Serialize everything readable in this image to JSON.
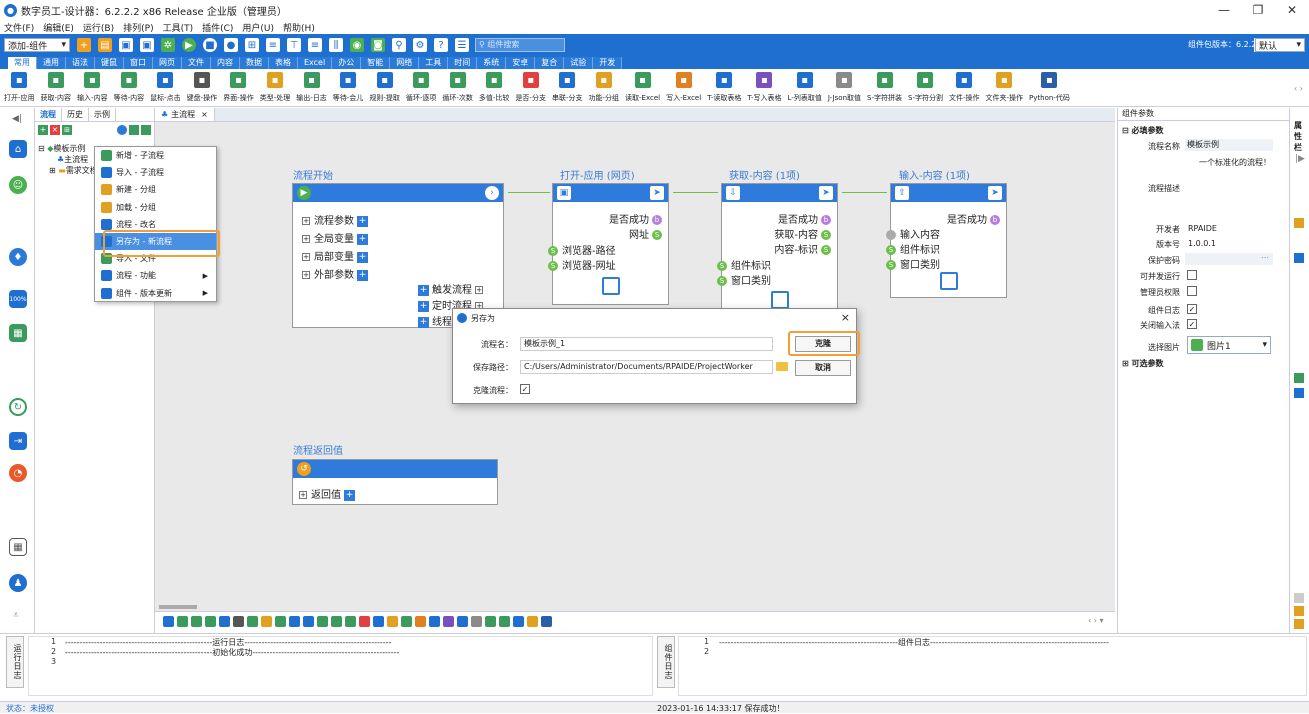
{
  "window": {
    "title": "数字员工-设计器：6.2.2.2 x86 Release 企业版（管理员）",
    "controls": [
      "—",
      "❐",
      "✕"
    ]
  },
  "menu": [
    "文件(F)",
    "编辑(E)",
    "运行(B)",
    "排列(P)",
    "工具(T)",
    "插件(C)",
    "用户(U)",
    "帮助(H)"
  ],
  "toolbar": {
    "mode": "添加-组件",
    "search_placeholder": "组件搜索",
    "version_label": "组件包版本：6.2.2.2",
    "default_label": "默认"
  },
  "category_tabs": [
    "常用",
    "通用",
    "语法",
    "键鼠",
    "窗口",
    "网页",
    "文件",
    "内容",
    "数据",
    "表格",
    "Excel",
    "办公",
    "智能",
    "网络",
    "工具",
    "时间",
    "系统",
    "安卓",
    "复合",
    "试验",
    "开发"
  ],
  "ribbon": [
    {
      "label": "打开-应用",
      "color": "#1f6fd1"
    },
    {
      "label": "获取-内容",
      "color": "#3a9b5c"
    },
    {
      "label": "输入-内容",
      "color": "#3a9b5c"
    },
    {
      "label": "等待-内容",
      "color": "#3a9b5c"
    },
    {
      "label": "鼠标-点击",
      "color": "#1f6fd1"
    },
    {
      "label": "键盘-操作",
      "color": "#555"
    },
    {
      "label": "界面-操作",
      "color": "#3a9b5c"
    },
    {
      "label": "类型-处理",
      "color": "#e0a020"
    },
    {
      "label": "输出-日志",
      "color": "#3a9b5c"
    },
    {
      "label": "等待-会儿",
      "color": "#1f6fd1"
    },
    {
      "label": "规则-提取",
      "color": "#1f6fd1"
    },
    {
      "label": "循环-逐项",
      "color": "#3a9b5c"
    },
    {
      "label": "循环-次数",
      "color": "#3a9b5c"
    },
    {
      "label": "多值-比较",
      "color": "#3a9b5c"
    },
    {
      "label": "是否-分支",
      "color": "#e04040"
    },
    {
      "label": "串联-分支",
      "color": "#1f6fd1"
    },
    {
      "label": "功能-分组",
      "color": "#e0a020"
    },
    {
      "label": "读取-Excel",
      "color": "#3a9b5c"
    },
    {
      "label": "写入-Excel",
      "color": "#e08020"
    },
    {
      "label": "T-读取表格",
      "color": "#1f6fd1"
    },
    {
      "label": "T-写入表格",
      "color": "#7a50c0"
    },
    {
      "label": "L-列表取值",
      "color": "#1f6fd1"
    },
    {
      "label": "J-Json取值",
      "color": "#8a8a8a"
    },
    {
      "label": "S-字符拼装",
      "color": "#3a9b5c"
    },
    {
      "label": "S-字符分割",
      "color": "#3a9b5c"
    },
    {
      "label": "文件-操作",
      "color": "#1f6fd1"
    },
    {
      "label": "文件夹-操作",
      "color": "#e0a020"
    },
    {
      "label": "Python-代码",
      "color": "#2b5ea8"
    }
  ],
  "left_panel": {
    "tabs": [
      "流程",
      "历史",
      "示例"
    ],
    "tree": {
      "root": "模板示例",
      "child1": "主流程",
      "child2": "需求文档"
    }
  },
  "context_menu": [
    {
      "label": "新增 - 子流程",
      "color": "#3a9b5c",
      "arrow": ""
    },
    {
      "label": "导入 - 子流程",
      "color": "#1f6fd1",
      "arrow": ""
    },
    {
      "label": "新建 - 分组",
      "color": "#e0a020",
      "arrow": ""
    },
    {
      "label": "加载 - 分组",
      "color": "#e0a020",
      "arrow": ""
    },
    {
      "label": "流程 - 改名",
      "color": "#1f6fd1",
      "arrow": ""
    },
    {
      "label": "另存为 - 新流程",
      "color": "#1f6fd1",
      "arrow": ""
    },
    {
      "label": "导入 - 文件",
      "color": "#3a9b5c",
      "arrow": ""
    },
    {
      "label": "流程 - 功能",
      "color": "#1f6fd1",
      "arrow": "▶"
    },
    {
      "label": "组件 - 版本更新",
      "color": "#1f6fd1",
      "arrow": "▶"
    }
  ],
  "canvas_tab": "主流程",
  "canvas": {
    "start": {
      "title": "流程开始",
      "rows": [
        "流程参数",
        "全局变量",
        "局部变量",
        "外部参数"
      ],
      "triggers": [
        "触发流程",
        "定时流程",
        "线程流程"
      ]
    },
    "open_app": {
      "title": "打开-应用 (网页)",
      "out1": "是否成功",
      "out2": "网址",
      "in1": "浏览器-路径",
      "in2": "浏览器-网址"
    },
    "get_content": {
      "title": "获取-内容 (1项)",
      "out1": "是否成功",
      "out2": "获取-内容",
      "out3": "内容-标识",
      "in1": "组件标识",
      "in2": "窗口类别"
    },
    "input_content": {
      "title": "输入-内容 (1项)",
      "out1": "是否成功",
      "in0": "输入内容",
      "in1": "组件标识",
      "in2": "窗口类别"
    },
    "return": {
      "title": "流程返回值",
      "row": "返回值"
    }
  },
  "dialog": {
    "title": "另存为",
    "name_label": "流程名：",
    "name_value": "模板示例_1",
    "path_label": "保存路径：",
    "path_value": "C:/Users/Administrator/Documents/RPAIDE/ProjectWorker",
    "clone_label": "克隆流程：",
    "clone_button": "克隆",
    "cancel_button": "取消"
  },
  "right_panel": {
    "tab": "组件参数",
    "required": "必填参数",
    "optional": "可选参数",
    "fields": {
      "name_label": "流程名称",
      "name_value": "模板示例",
      "desc_label": "流程描述",
      "desc_value": "一个标准化的流程！",
      "dev_label": "开发者",
      "dev_value": "RPAIDE",
      "ver_label": "版本号",
      "ver_value": "1.0.0.1",
      "pwd_label": "保护密码",
      "concurrent_label": "可并发运行",
      "admin_label": "管理员权限",
      "log_label": "组件日志",
      "ime_label": "关闭输入法",
      "image_label": "选择图片",
      "image_value": "图片1"
    },
    "side_tabs": "属性栏"
  },
  "logs": {
    "left_title": "运行日志",
    "right_title": "组件日志",
    "left_lines": [
      {
        "n": "1",
        "text": "---------------------------------------------------运行日志---------------------------------------------------"
      },
      {
        "n": "2",
        "text": "---------------------------------------------------初始化成功---------------------------------------------------"
      },
      {
        "n": "3",
        "text": ""
      }
    ],
    "right_lines": [
      {
        "n": "1",
        "text": "--------------------------------------------------------------组件日志--------------------------------------------------------------"
      },
      {
        "n": "2",
        "text": ""
      }
    ]
  },
  "status": {
    "left": "状态：未授权",
    "center": "2023-01-16 14:33:17 保存成功！"
  }
}
